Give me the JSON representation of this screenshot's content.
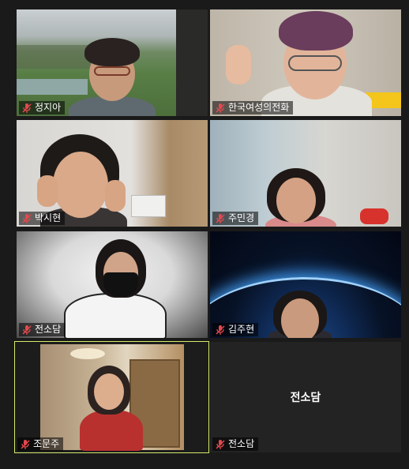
{
  "tiles": [
    {
      "name": "정지아",
      "muted": true
    },
    {
      "name": "한국여성의전화",
      "muted": true
    },
    {
      "name": "박시현",
      "muted": true
    },
    {
      "name": "주민경",
      "muted": true
    },
    {
      "name": "전소담",
      "muted": true
    },
    {
      "name": "김주현",
      "muted": true
    },
    {
      "name": "조문주",
      "muted": true,
      "active_speaker": true
    },
    {
      "name": "전소담",
      "muted": true,
      "video_off": true,
      "center_label": "전소담"
    }
  ],
  "colors": {
    "active_border": "#d4ea6b",
    "muted_icon": "#e5484d",
    "background": "#1a1a1a"
  },
  "icons": {
    "muted": "mic-off-icon"
  }
}
